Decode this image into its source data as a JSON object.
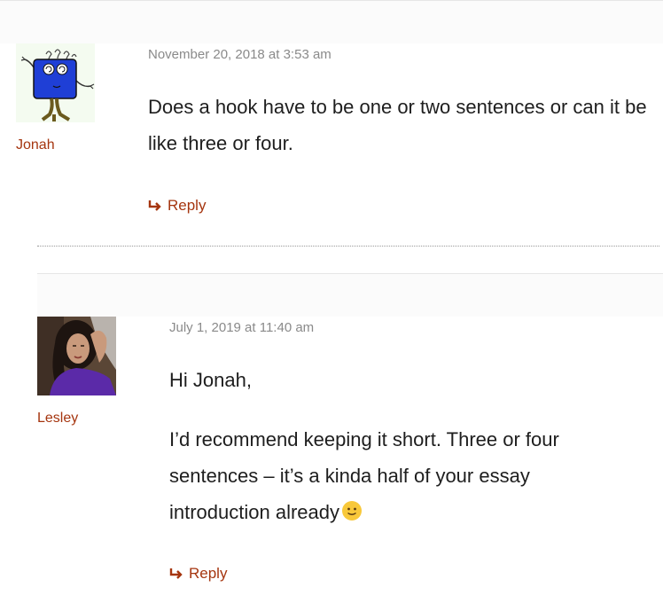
{
  "comments": [
    {
      "author": "Jonah",
      "date": "November 20, 2018 at 3:53 am",
      "text": "Does a hook have to be one or two sentences or can it be like three or four.",
      "reply_label": "Reply",
      "avatar_icon": "cartoon-monster-avatar"
    },
    {
      "author": "Lesley",
      "date": "July 1, 2019 at 11:40 am",
      "greeting": "Hi Jonah,",
      "text": "I’d recommend keeping it short. Three or four sentences – it’s a kinda half of your essay introduction already",
      "emoji": "slightly-smiling-face",
      "reply_label": "Reply",
      "avatar_icon": "woman-photo-avatar"
    }
  ],
  "colors": {
    "accent": "#a5350f",
    "meta": "#8a8a8a",
    "text": "#1e1e1e",
    "band": "#fbfbfb"
  }
}
